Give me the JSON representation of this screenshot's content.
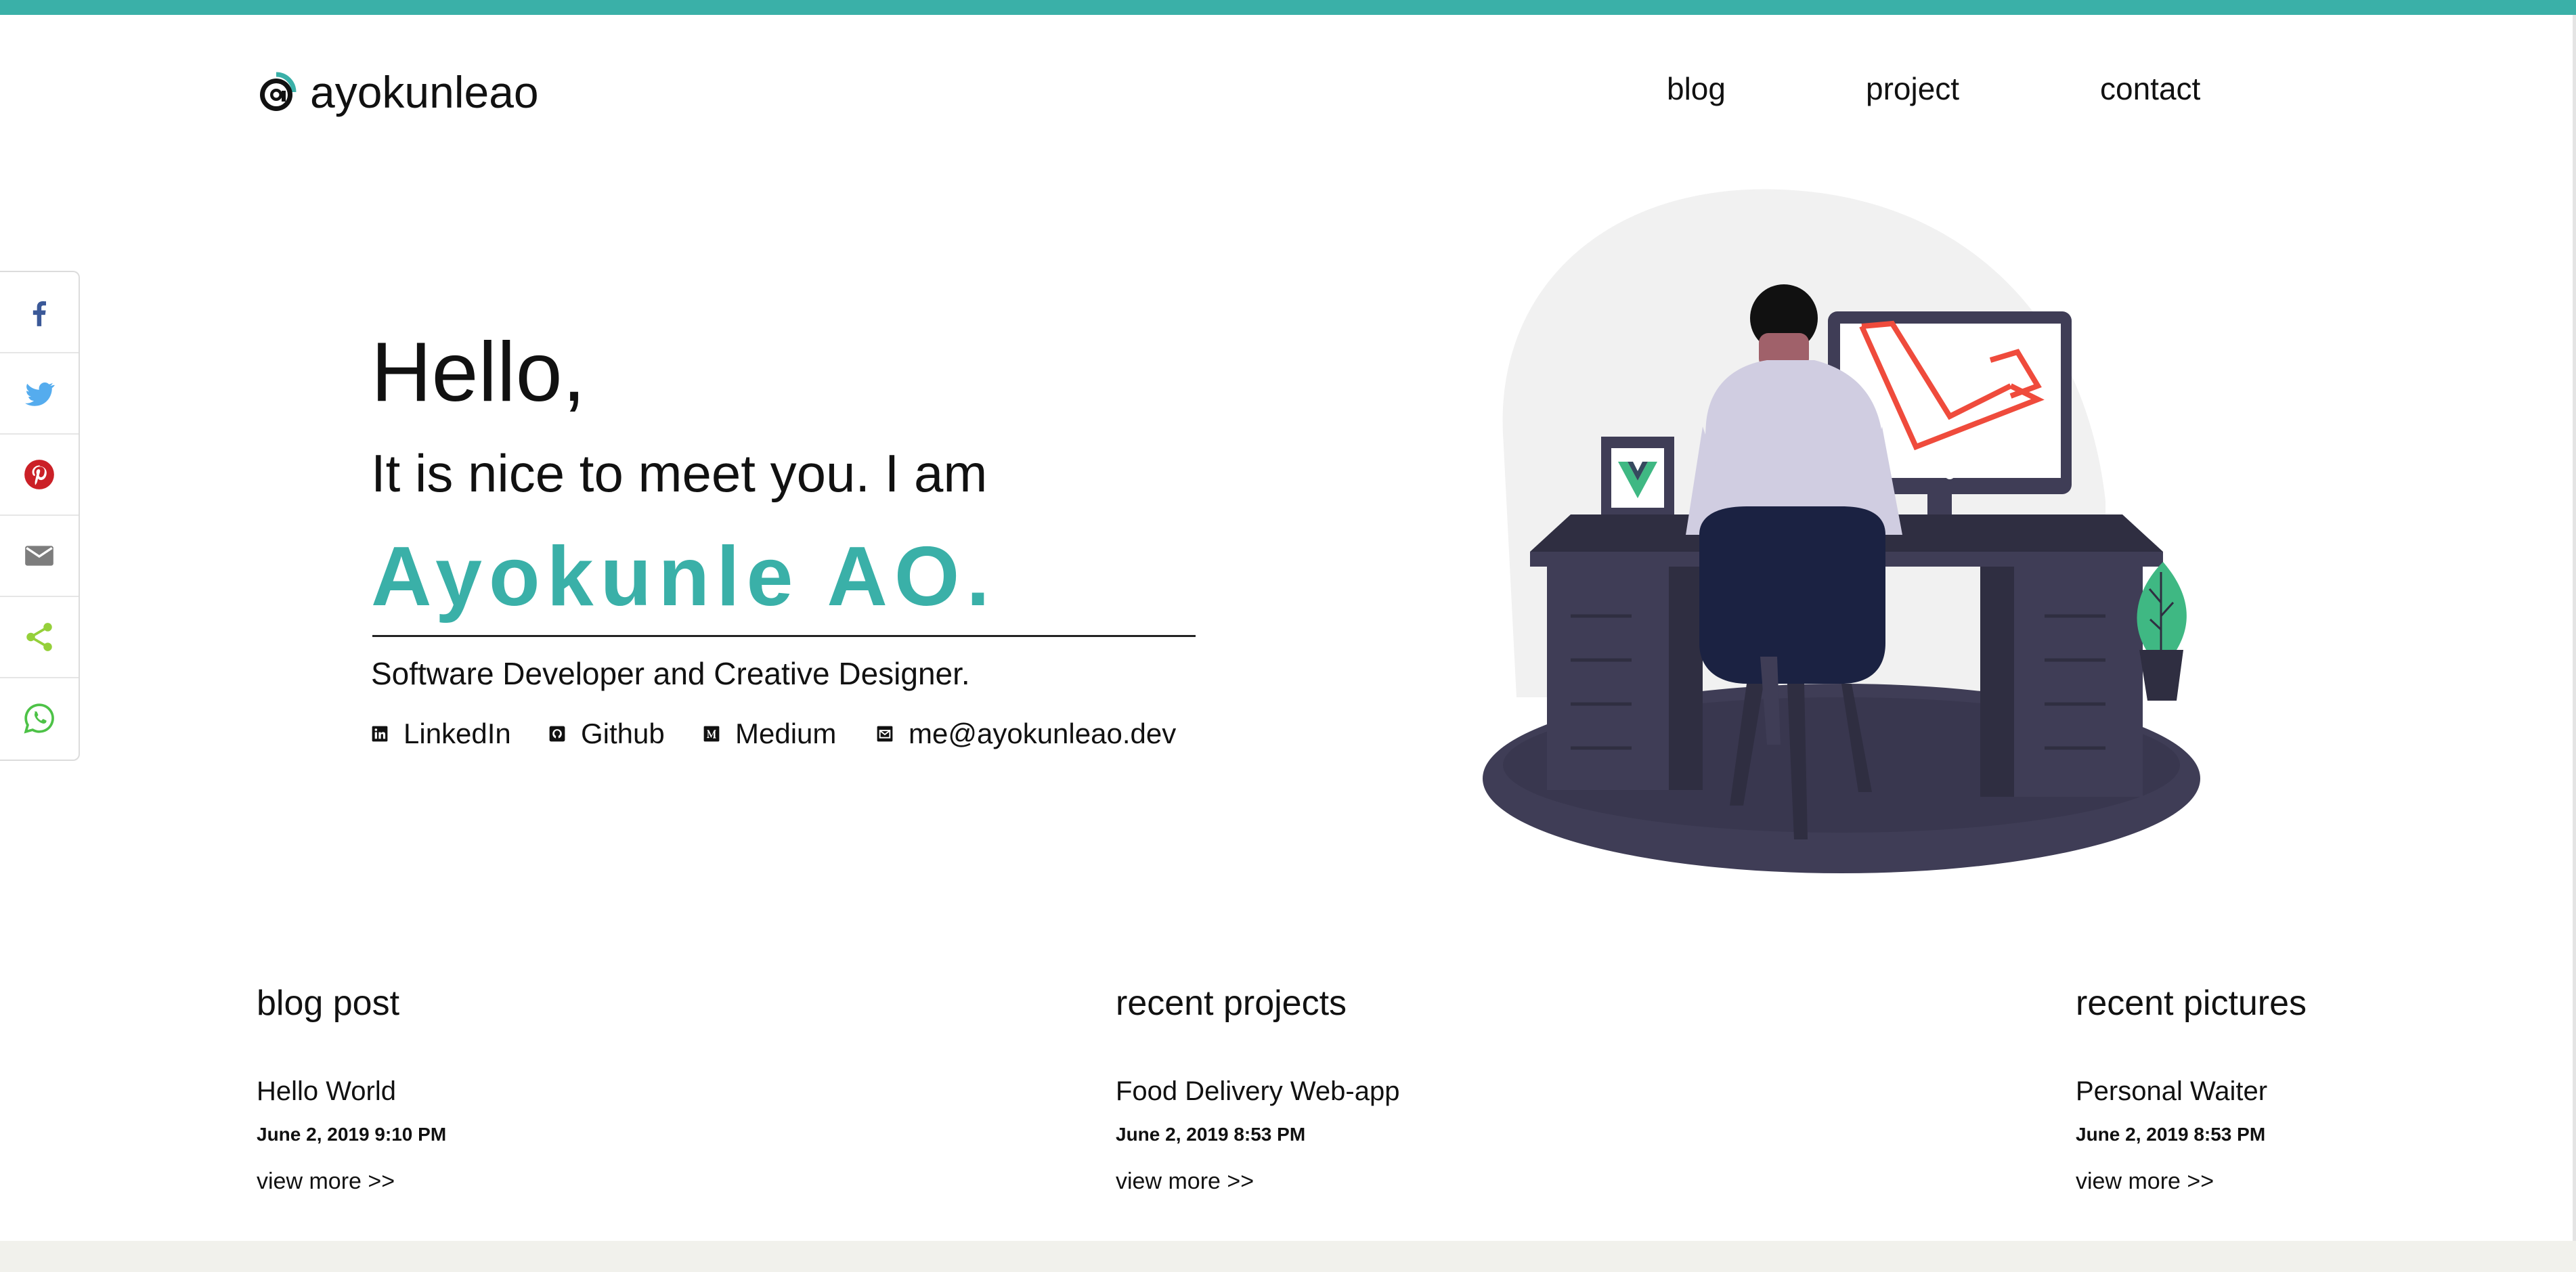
{
  "colors": {
    "accent": "#3ab0a8",
    "footer_band": "#f1f1ec"
  },
  "header": {
    "logo_icon": "at-sign-logo",
    "site_name": "ayokunleao",
    "nav": [
      {
        "label": "blog"
      },
      {
        "label": "project"
      },
      {
        "label": "contact"
      }
    ]
  },
  "share": [
    {
      "icon": "facebook-icon",
      "color": "#3b5998"
    },
    {
      "icon": "twitter-icon",
      "color": "#55acee"
    },
    {
      "icon": "pinterest-icon",
      "color": "#cb2027"
    },
    {
      "icon": "email-icon",
      "color": "#7d7d7d"
    },
    {
      "icon": "share-icon",
      "color": "#95d03a"
    },
    {
      "icon": "whatsapp-icon",
      "color": "#4dc247"
    }
  ],
  "hero": {
    "greeting": "Hello,",
    "intro": "It is nice to meet you. I am",
    "name": "Ayokunle AO.",
    "tagline": "Software Developer and Creative Designer.",
    "links": [
      {
        "icon": "linkedin-icon",
        "label": "LinkedIn"
      },
      {
        "icon": "github-icon",
        "label": "Github"
      },
      {
        "icon": "medium-icon",
        "label": "Medium"
      },
      {
        "icon": "mail-icon",
        "label": "me@ayokunleao.dev"
      }
    ]
  },
  "sections": [
    {
      "title": "blog post",
      "item_title": "Hello World",
      "date": "June 2, 2019 9:10 PM",
      "more": "view more >>"
    },
    {
      "title": "recent projects",
      "item_title": "Food Delivery Web-app",
      "date": "June 2, 2019 8:53 PM",
      "more": "view more >>"
    },
    {
      "title": "recent pictures",
      "item_title": "Personal Waiter",
      "date": "June 2, 2019 8:53 PM",
      "more": "view more >>"
    }
  ]
}
